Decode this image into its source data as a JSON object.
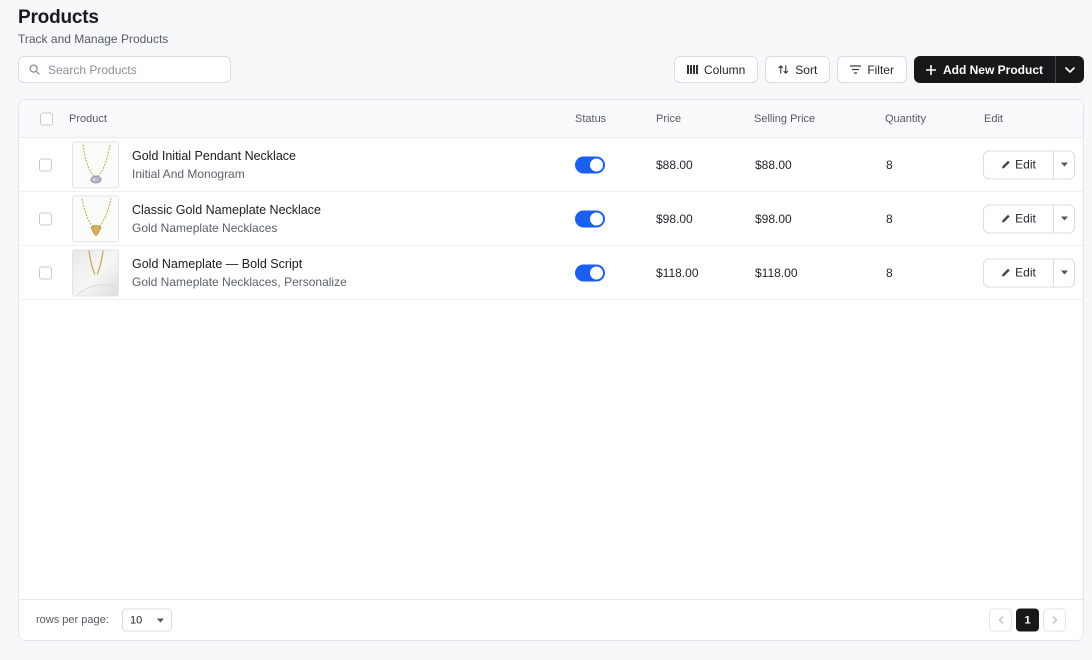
{
  "header": {
    "title": "Products",
    "subtitle": "Track and Manage Products"
  },
  "search": {
    "placeholder": "Search Products"
  },
  "toolbar": {
    "column_label": "Column",
    "sort_label": "Sort",
    "filter_label": "Filter",
    "add_label": "Add New Product"
  },
  "table": {
    "columns": {
      "product": "Product",
      "status": "Status",
      "price": "Price",
      "selling_price": "Selling Price",
      "quantity": "Quantity",
      "edit": "Edit"
    },
    "rows": [
      {
        "name": "Gold Initial Pendant Necklace",
        "category": "Initial And Monogram",
        "status_on": true,
        "price": "$88.00",
        "selling_price": "$88.00",
        "quantity": "8",
        "edit_label": "Edit"
      },
      {
        "name": "Classic Gold Nameplate Necklace",
        "category": "Gold Nameplate Necklaces",
        "status_on": true,
        "price": "$98.00",
        "selling_price": "$98.00",
        "quantity": "8",
        "edit_label": "Edit"
      },
      {
        "name": "Gold Nameplate — Bold Script",
        "category": "Gold Nameplate Necklaces, Personalize",
        "status_on": true,
        "price": "$118.00",
        "selling_price": "$118.00",
        "quantity": "8",
        "edit_label": "Edit"
      }
    ]
  },
  "footer": {
    "rows_per_page_label": "rows per page:",
    "rows_per_page_value": "10",
    "current_page": "1"
  },
  "colors": {
    "accent": "#1a5ff0",
    "primary_button": "#17181a",
    "background": "#f7f8fa"
  }
}
